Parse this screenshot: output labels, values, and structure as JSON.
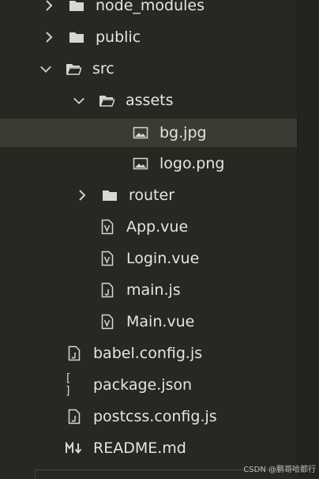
{
  "tree": {
    "items": [
      {
        "label": "node_modules",
        "type": "folder",
        "state": "collapsed"
      },
      {
        "label": "public",
        "type": "folder",
        "state": "collapsed"
      },
      {
        "label": "src",
        "type": "folder",
        "state": "expanded"
      },
      {
        "label": "assets",
        "type": "folder",
        "state": "expanded"
      },
      {
        "label": "bg.jpg",
        "type": "image",
        "selected": true
      },
      {
        "label": "logo.png",
        "type": "image"
      },
      {
        "label": "router",
        "type": "folder",
        "state": "collapsed"
      },
      {
        "label": "App.vue",
        "type": "vue"
      },
      {
        "label": "Login.vue",
        "type": "vue"
      },
      {
        "label": "main.js",
        "type": "js"
      },
      {
        "label": "Main.vue",
        "type": "vue"
      },
      {
        "label": "babel.config.js",
        "type": "js"
      },
      {
        "label": "package.json",
        "type": "json",
        "glyph": "[ ]"
      },
      {
        "label": "postcss.config.js",
        "type": "js"
      },
      {
        "label": "README.md",
        "type": "markdown"
      }
    ]
  },
  "watermark": "CSDN @鹏哥哈都行",
  "colors": {
    "background": "#272822",
    "selected_row": "#3b3b34",
    "text": "#e6e6e0"
  }
}
